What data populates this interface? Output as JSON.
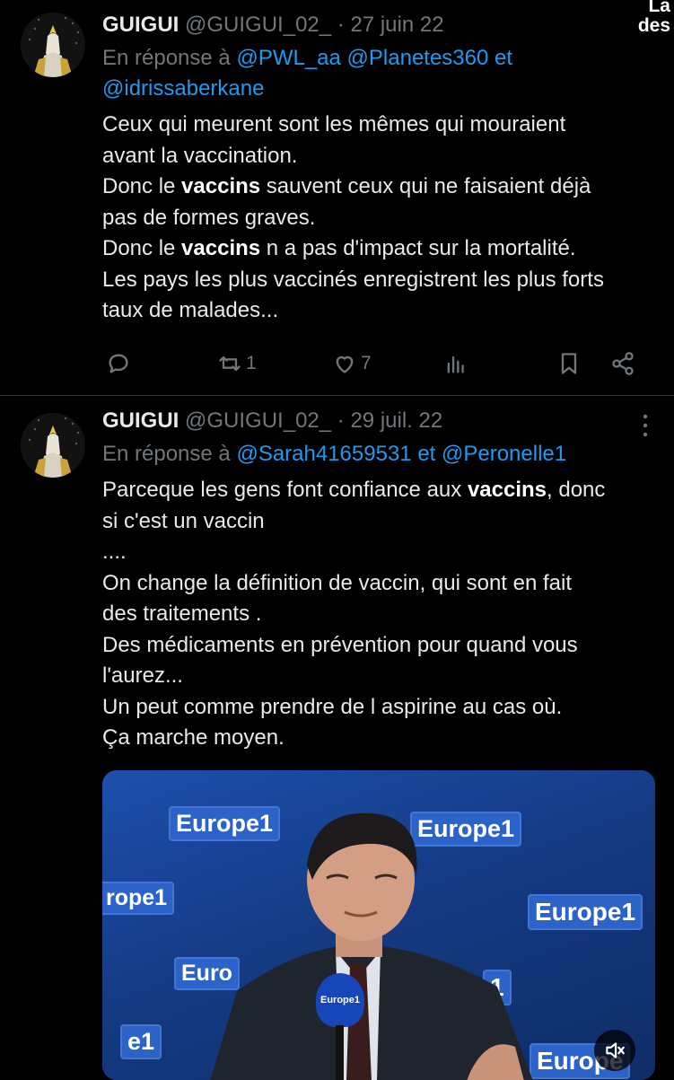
{
  "corner": {
    "line1": "La",
    "line2": "des"
  },
  "tweets": [
    {
      "author_name": "GUIGUI",
      "handle": "@GUIGUI_02_",
      "separator": "·",
      "date": "27 juin 22",
      "reply_prefix": "En réponse à",
      "reply_mentions": [
        "@PWL_aa",
        "@Planetes360"
      ],
      "reply_conj": "et",
      "reply_last": "@idrissaberkane",
      "body": {
        "l1": "Ceux qui meurent sont les mêmes qui mouraient",
        "l2": "avant la vaccination.",
        "l3a": "Donc le ",
        "l3b": "vaccins",
        "l3c": " sauvent ceux qui ne faisaient déjà",
        "l4": "pas de formes graves.",
        "l5a": "Donc le ",
        "l5b": "vaccins",
        "l5c": " n a pas d'impact sur la mortalité.",
        "l6": "Les pays les plus vaccinés enregistrent les plus forts",
        "l7": "taux de malades..."
      },
      "actions": {
        "retweets": "1",
        "likes": "7"
      }
    },
    {
      "author_name": "GUIGUI",
      "handle": "@GUIGUI_02_",
      "separator": "·",
      "date": "29 juil. 22",
      "reply_prefix": "En réponse à",
      "reply_mentions": [
        "@Sarah41659531",
        "@Peronelle1"
      ],
      "reply_conj": "et",
      "body": {
        "l1a": "Parceque les gens font confiance aux ",
        "l1b": "vaccins",
        "l1c": ", donc",
        "l2": "si c'est un vaccin",
        "l3": "....",
        "l4": "On change la définition de vaccin, qui sont en fait",
        "l5": "des traitements .",
        "l6": "Des médicaments en prévention pour quand vous",
        "l7": "l'aurez...",
        "l8": "Un peut comme prendre de l aspirine au cas où.",
        "l9": "Ça marche moyen."
      },
      "media": {
        "logo1": "Europe1",
        "logo2": "Europe1",
        "logo3": "rope1",
        "logo4": "Europe1",
        "logo5": "Euro",
        "logo6": "1",
        "logo7": "e1",
        "logo8": "Europe",
        "mic": "Europe1"
      }
    }
  ],
  "icons": [
    "reply-icon",
    "retweet-icon",
    "like-icon",
    "views-icon",
    "bookmark-icon",
    "share-icon",
    "more-icon",
    "mute-icon"
  ],
  "colors": {
    "background": "#000000",
    "text": "#e7e9ea",
    "muted": "#71767b",
    "link": "#1d9bf0",
    "brand_blue": "#2b63c9"
  }
}
